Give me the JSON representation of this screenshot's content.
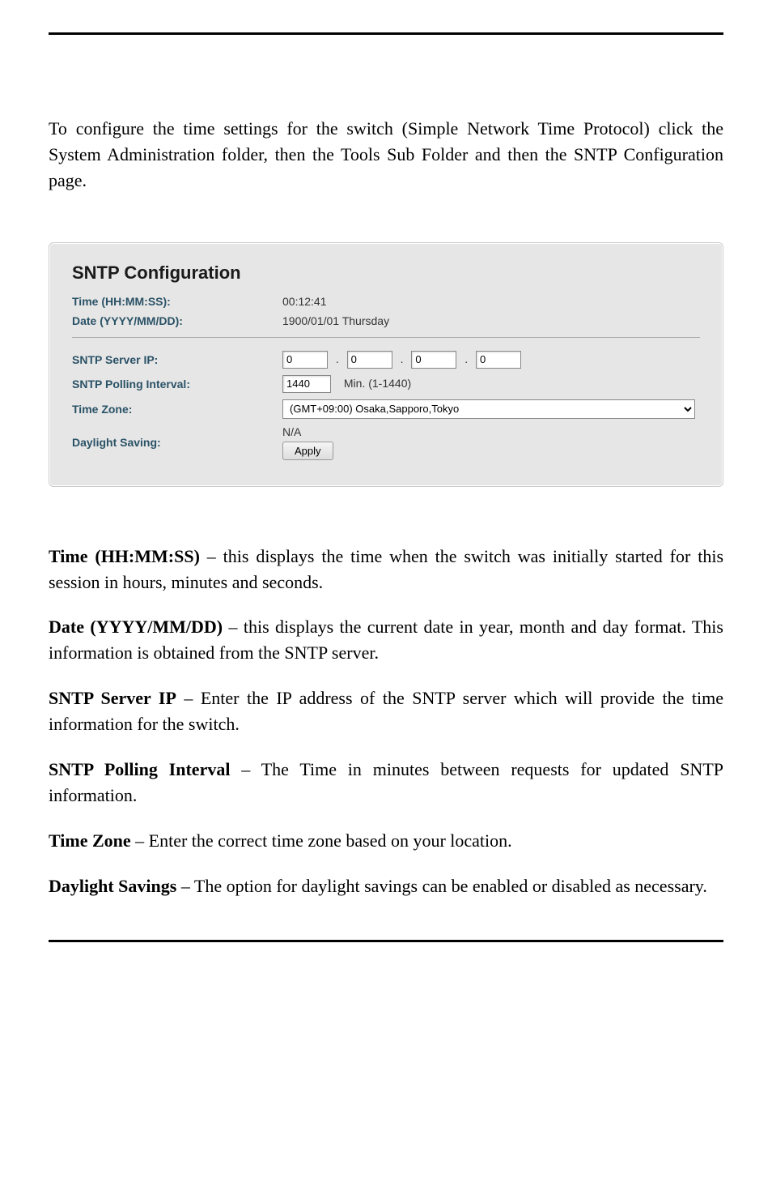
{
  "intro": "To configure the time settings for the switch (Simple Network Time Protocol) click the System Administration folder, then the Tools Sub Folder and then the SNTP Configuration page.",
  "panel": {
    "title": "SNTP Configuration",
    "time_label": "Time (HH:MM:SS):",
    "time_value": "00:12:41",
    "date_label": "Date (YYYY/MM/DD):",
    "date_value": "1900/01/01 Thursday",
    "server_ip_label": "SNTP Server IP:",
    "ip": {
      "a": "0",
      "b": "0",
      "c": "0",
      "d": "0"
    },
    "polling_label": "SNTP Polling Interval:",
    "polling_value": "1440",
    "polling_suffix": "Min. (1-1440)",
    "timezone_label": "Time Zone:",
    "timezone_value": "(GMT+09:00) Osaka,Sapporo,Tokyo",
    "daylight_label": "Daylight Saving:",
    "daylight_value": "N/A",
    "apply_label": "Apply"
  },
  "definitions": {
    "time": {
      "term": "Time (HH:MM:SS)",
      "desc": " – this displays the time when the switch was initially started for this session in hours, minutes and seconds."
    },
    "date": {
      "term": "Date (YYYY/MM/DD)",
      "desc": " – this displays the current date in year, month and day format.  This information is obtained from the SNTP server."
    },
    "server_ip": {
      "term": "SNTP Server IP",
      "desc": " – Enter the IP address of the SNTP server which will provide the time information for the switch."
    },
    "polling": {
      "term": "SNTP Polling Interval",
      "desc": " – The Time in minutes between requests for updated SNTP information."
    },
    "timezone": {
      "term": "Time Zone",
      "desc": " – Enter the correct time zone based on your location."
    },
    "daylight": {
      "term": "Daylight Savings",
      "desc": " – The option for daylight savings can be enabled or disabled as necessary."
    }
  }
}
